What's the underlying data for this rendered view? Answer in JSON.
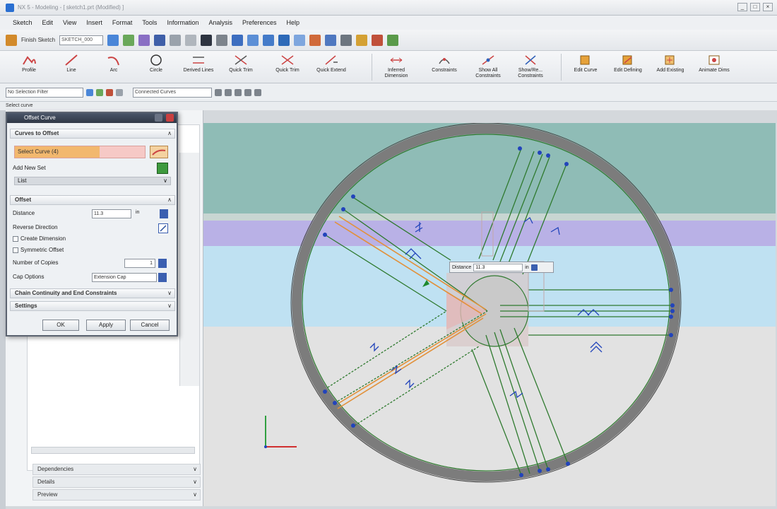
{
  "window": {
    "title": "NX 5 - Modeling - [ sketch1.prt (Modified) ]",
    "controls": [
      "_",
      "□",
      "×"
    ]
  },
  "menubar": [
    "Sketch",
    "Edit",
    "View",
    "Insert",
    "Format",
    "Tools",
    "Information",
    "Analysis",
    "Preferences",
    "Help"
  ],
  "quickbar": {
    "sketch_label": "Finish Sketch",
    "sketch_name": "SKETCH_000"
  },
  "ribbon": {
    "tools": [
      {
        "label": "Profile"
      },
      {
        "label": "Line"
      },
      {
        "label": "Arc"
      },
      {
        "label": "Circle"
      },
      {
        "label": "Derived Lines"
      },
      {
        "label": "Quick Trim"
      },
      {
        "label": "Quick Trim"
      },
      {
        "label": "Quick Extend"
      },
      {
        "label": "Inferred Dimension"
      },
      {
        "label": "Constraints"
      },
      {
        "label": "Show All Constraints"
      },
      {
        "label": "Show/Re... Constraints"
      },
      {
        "label": "Edit Curve"
      },
      {
        "label": "Edit Defining"
      },
      {
        "label": "Add Existing"
      },
      {
        "label": "Animate Dims"
      }
    ]
  },
  "selection": {
    "filter": "No Selection Filter",
    "scope": "Connected Curves"
  },
  "cmdline": "Select curve",
  "dialog": {
    "title": "Offset Curve",
    "sections": {
      "curves": "Curves to Offset",
      "offset": "Offset",
      "chain": "Chain Continuity and End Constraints",
      "settings": "Settings"
    },
    "select_curve": "Select Curve (4)",
    "add_new_set": "Add New Set",
    "list": "List",
    "distance_label": "Distance",
    "distance_value": "11.3",
    "distance_unit": "in",
    "reverse_direction": "Reverse Direction",
    "create_dimension": "Create Dimension",
    "symmetric_offset": "Symmetric Offset",
    "copies_label": "Number of Copies",
    "copies_value": "1",
    "cap_label": "Cap Options",
    "cap_value": "Extension Cap",
    "ok": "OK",
    "apply": "Apply",
    "cancel": "Cancel"
  },
  "navigator": {
    "sections": [
      "Dependencies",
      "Details",
      "Preview"
    ]
  },
  "viewport": {
    "distance_label": "Distance",
    "distance_value": "11.3",
    "distance_unit": "in"
  },
  "colors": {
    "ring": "#7c7c7c",
    "curve": "#2f7a2f",
    "offset": "#e2913a",
    "point": "#2244bb",
    "band_teal": "#8fbcb6",
    "band_lavender": "#b9b1e6",
    "band_blue": "#bfe1f2"
  }
}
